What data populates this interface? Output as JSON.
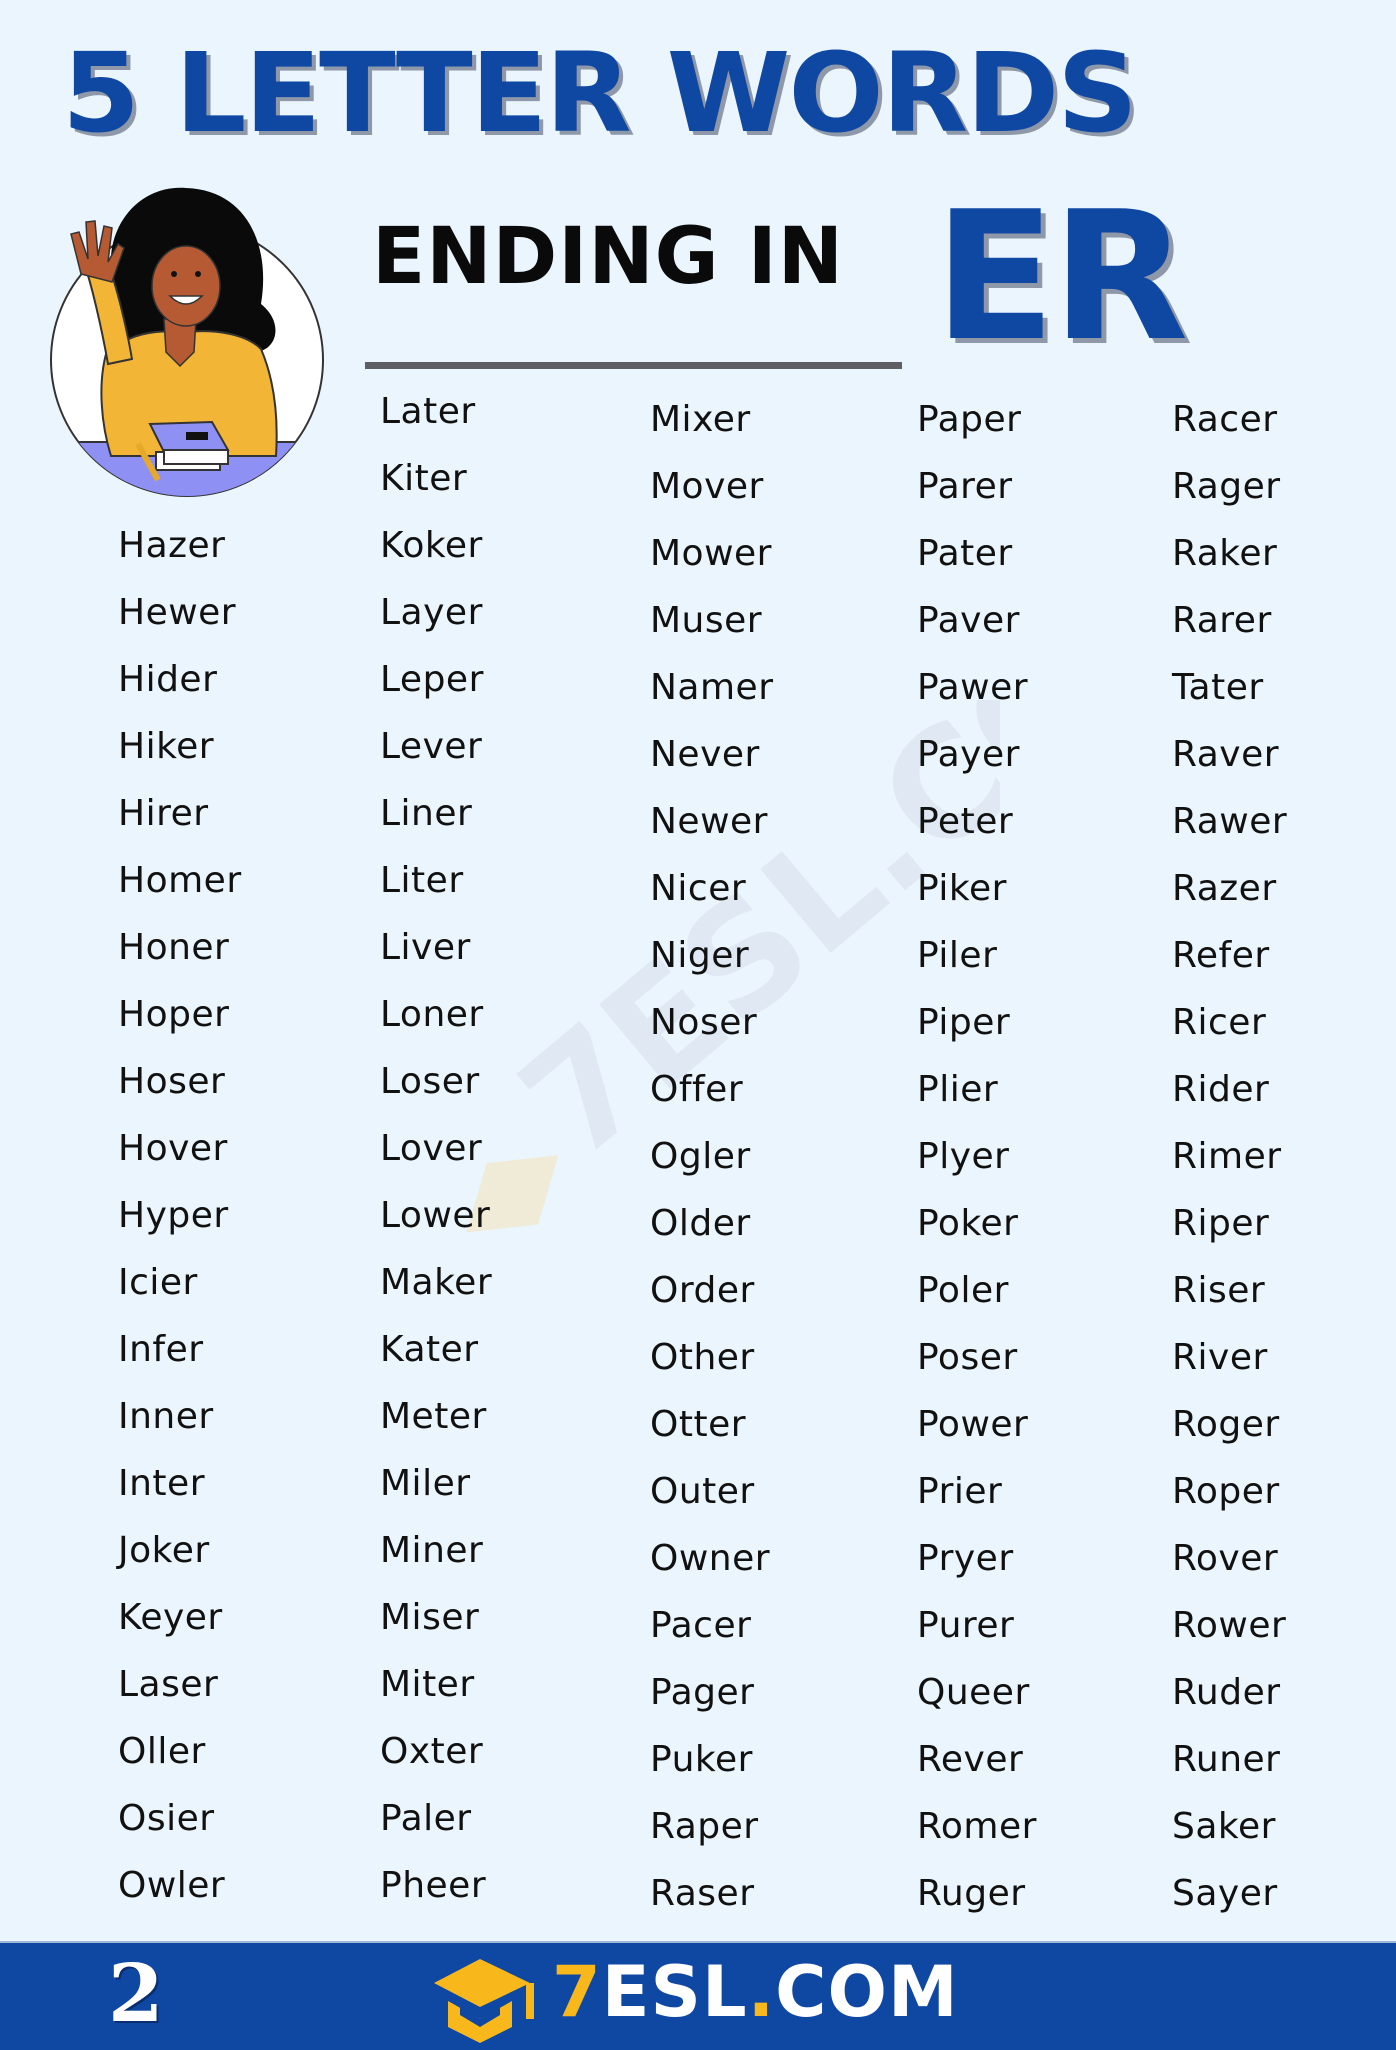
{
  "header": {
    "title": "5 LETTER WORDS",
    "subtitle": "ENDING IN",
    "suffix": "ER"
  },
  "colors": {
    "brand_blue": "#0f48a3",
    "background": "#ebf5fe",
    "accent_yellow": "#f8b81c",
    "divider_gray": "#5f5f63",
    "text": "#111111"
  },
  "illustration": {
    "subject": "woman waving with books"
  },
  "word_columns": [
    [
      "Hazer",
      "Hewer",
      "Hider",
      "Hiker",
      "Hirer",
      "Homer",
      "Honer",
      "Hoper",
      "Hoser",
      "Hover",
      "Hyper",
      "Icier",
      "Infer",
      "Inner",
      "Inter",
      "Joker",
      "Keyer",
      "Laser",
      "Oller",
      "Osier",
      "Owler"
    ],
    [
      "Later",
      "Kiter",
      "Koker",
      "Layer",
      "Leper",
      "Lever",
      "Liner",
      "Liter",
      "Liver",
      "Loner",
      "Loser",
      "Lover",
      "Lower",
      "Maker",
      "Kater",
      "Meter",
      "Miler",
      "Miner",
      "Miser",
      "Miter",
      "Oxter",
      "Paler",
      "Pheer"
    ],
    [
      "Mixer",
      "Mover",
      "Mower",
      "Muser",
      "Namer",
      "Never",
      "Newer",
      "Nicer",
      "Niger",
      "Noser",
      "Offer",
      "Ogler",
      "Older",
      "Order",
      "Other",
      "Otter",
      "Outer",
      "Owner",
      "Pacer",
      "Pager",
      "Puker",
      "Raper",
      "Raser"
    ],
    [
      "Paper",
      "Parer",
      "Pater",
      "Paver",
      "Pawer",
      "Payer",
      "Peter",
      "Piker",
      "Piler",
      "Piper",
      "Plier",
      "Plyer",
      "Poker",
      "Poler",
      "Poser",
      "Power",
      "Prier",
      "Pryer",
      "Purer",
      "Queer",
      "Rever",
      "Romer",
      "Ruger"
    ],
    [
      "Racer",
      "Rager",
      "Raker",
      "Rarer",
      "Tater",
      "Raver",
      "Rawer",
      "Razer",
      "Refer",
      "Ricer",
      "Rider",
      "Rimer",
      "Riper",
      "Riser",
      "River",
      "Roger",
      "Roper",
      "Rover",
      "Rower",
      "Ruder",
      "Runer",
      "Saker",
      "Sayer"
    ]
  ],
  "watermark": "7ESL.COM",
  "footer": {
    "page_number": "2",
    "logo_prefix": "7",
    "logo_main": "ESL",
    "logo_dot": ".",
    "logo_suffix": "COM"
  }
}
